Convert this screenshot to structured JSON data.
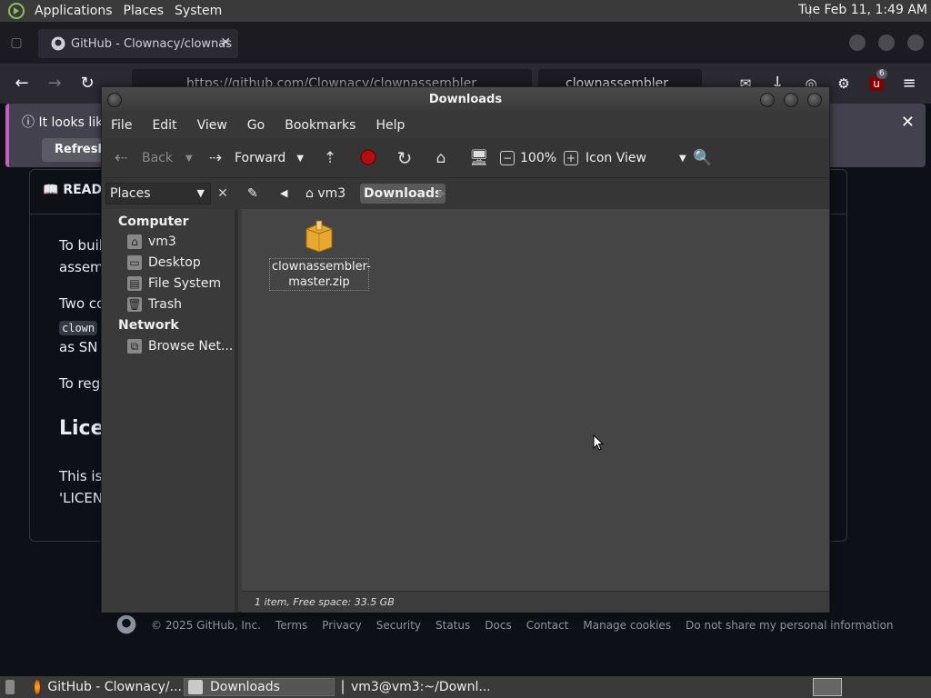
{
  "top_panel": {
    "menus": [
      "Applications",
      "Places",
      "System"
    ],
    "clock": "Tue Feb 11,  1:49 AM"
  },
  "browser": {
    "tab_title": "GitHub - Clownacy/clownas",
    "url": "https://github.com/Clownacy/clownassembler",
    "search_text": "clownassembler",
    "extension_badge": "6",
    "notice_text": "It looks like",
    "notice_button": "Refresh F",
    "readme_tab": "READ",
    "lines": [
      "To buil",
      "assem",
      "Two co",
      "clown",
      "as SN",
      "To reg",
      "Lice",
      "This is",
      "'LICEN"
    ],
    "footer": [
      "© 2025 GitHub, Inc.",
      "Terms",
      "Privacy",
      "Security",
      "Status",
      "Docs",
      "Contact",
      "Manage cookies",
      "Do not share my personal information"
    ]
  },
  "file_manager": {
    "title": "Downloads",
    "menus": [
      "File",
      "Edit",
      "View",
      "Go",
      "Bookmarks",
      "Help"
    ],
    "toolbar": {
      "back": "Back",
      "forward": "Forward",
      "zoom": "100%",
      "view_mode": "Icon View"
    },
    "places_combo": "Places",
    "breadcrumb": [
      "vm3",
      "Downloads"
    ],
    "sidebar": {
      "computer_header": "Computer",
      "computer_items": [
        "vm3",
        "Desktop",
        "File System",
        "Trash"
      ],
      "network_header": "Network",
      "network_items": [
        "Browse Net..."
      ]
    },
    "files": [
      {
        "name_line1": "clownassembler-",
        "name_line2": "master.zip"
      }
    ],
    "status": "1 item, Free space: 33.5 GB"
  },
  "taskbar": {
    "tasks": [
      "GitHub - Clownacy/...",
      "Downloads",
      "vm3@vm3:~/Downl..."
    ]
  }
}
